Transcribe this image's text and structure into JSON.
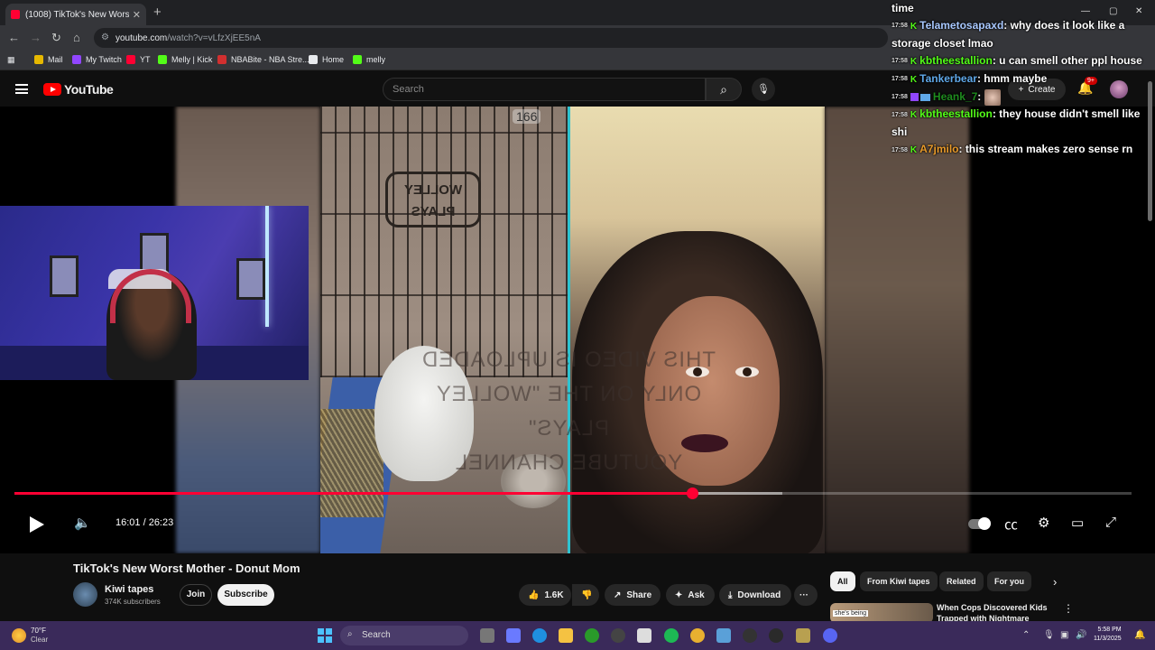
{
  "browser": {
    "tab_title": "(1008) TikTok's New Worst Mot",
    "tab_close": "✕",
    "new_tab": "+",
    "url_host": "youtube.com",
    "url_path": "/watch?v=vLfzXjEE5nA",
    "bookmarks": [
      "Mail",
      "My Twitch",
      "YT",
      "Melly | Kick",
      "NBABite - NBA Stre...",
      "Home",
      "melly"
    ],
    "bookmark_colors": [
      "#e6b800",
      "#9146ff",
      "#ff0033",
      "#53fc18",
      "#d12f2f",
      "#e8eaed",
      "#53fc18"
    ]
  },
  "youtube": {
    "logo_text": "YouTube",
    "search_placeholder": "Search",
    "create_label": "Create",
    "notif_badge": "9+"
  },
  "player": {
    "current_time": "16:01",
    "duration": "26:23",
    "time_display": "16:01 / 26:23",
    "progress_fraction": 0.607,
    "buffer_fraction": 0.687,
    "view_counter": "166",
    "watermark_lines": [
      "THIS VIDEO IS UPLOADED",
      "ONLY ON THE \"WOLLEY PLAYS\"",
      "YOUTUBE CHANNEL"
    ],
    "cage_logo": "WOLLEY PLAYS"
  },
  "video": {
    "title": "TikTok's New Worst Mother - Donut Mom",
    "channel_name": "Kiwi tapes",
    "channel_subs": "374K subscribers",
    "join_label": "Join",
    "subscribe_label": "Subscribe",
    "likes": "1.6K",
    "share_label": "Share",
    "ask_label": "Ask",
    "download_label": "Download",
    "more_label": "···"
  },
  "recommendations": {
    "chips": [
      "All",
      "From Kiwi tapes",
      "Related",
      "For you"
    ],
    "first_title": "When Cops Discovered Kids Trapped with Nightmare",
    "first_thumb_text": "she's being"
  },
  "chat": {
    "top_line": "time",
    "messages": [
      {
        "ts": "17:58",
        "user": "Telametosapaxd",
        "color": "#a8c8ff",
        "text": ": why does it look like a storage closet lmao",
        "badge": "kick"
      },
      {
        "ts": "17:58",
        "user": "kbtheestallion",
        "color": "#53fc18",
        "text": ": u can smell other ppl house",
        "badge": "kick"
      },
      {
        "ts": "17:58",
        "user": "Tankerbear",
        "color": "#5fa8e8",
        "text": ": hmm maybe",
        "badge": "kick"
      },
      {
        "ts": "17:58",
        "user": "Heank_7",
        "color": "#1e8c1e",
        "text": ":",
        "badge": "twitch"
      },
      {
        "ts": "17:58",
        "user": "kbtheestallion",
        "color": "#53fc18",
        "text": ": they house didn't smell like shi",
        "badge": "kick"
      },
      {
        "ts": "17:58",
        "user": "A7jmilo",
        "color": "#e89a2a",
        "text": ": this stream makes zero sense rn",
        "badge": "kick"
      }
    ]
  },
  "taskbar": {
    "temp": "70°F",
    "condition": "Clear",
    "search_label": "Search",
    "time": "5:58 PM",
    "date": "11/3/2025"
  }
}
